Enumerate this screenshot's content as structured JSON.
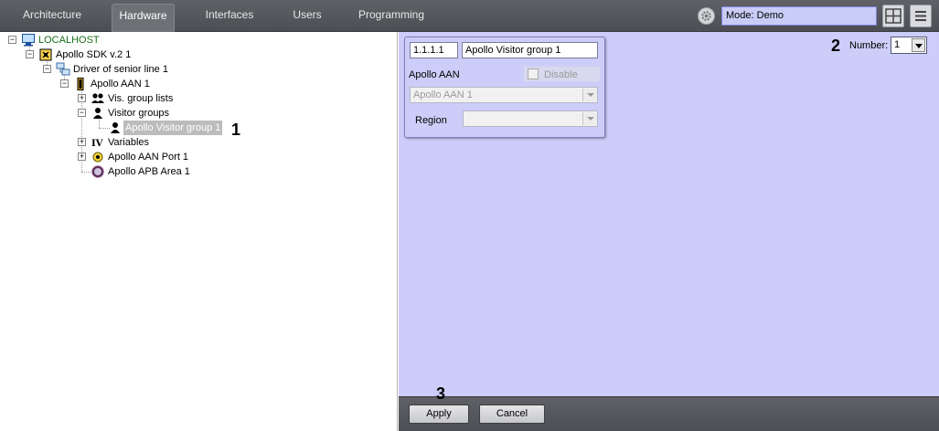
{
  "tabs": [
    {
      "label": "Architecture"
    },
    {
      "label": "Hardware"
    },
    {
      "label": "Interfaces"
    },
    {
      "label": "Users"
    },
    {
      "label": "Programming"
    }
  ],
  "active_tab": "Hardware",
  "mode_box": {
    "text": "Mode: Demo"
  },
  "tree": {
    "items": [
      {
        "label": "LOCALHOST",
        "icon": "computer-icon",
        "color": "#1a6e1a"
      },
      {
        "label": "Apollo SDK v.2 1",
        "icon": "chip-icon"
      },
      {
        "label": "Driver of senior line 1",
        "icon": "network-icon"
      },
      {
        "label": "Apollo AAN 1",
        "icon": "device-icon"
      },
      {
        "label": "Vis. group lists",
        "icon": "users-icon"
      },
      {
        "label": "Visitor groups",
        "icon": "user-icon"
      },
      {
        "label": "Apollo Visitor group 1",
        "icon": "user-icon",
        "selected": true
      },
      {
        "label": "Variables",
        "icon": "variables-icon"
      },
      {
        "label": "Apollo AAN Port 1",
        "icon": "port-icon"
      },
      {
        "label": "Apollo APB Area 1",
        "icon": "area-icon"
      }
    ]
  },
  "markers": {
    "m1": "1",
    "m2": "2",
    "m3": "3"
  },
  "settings": {
    "id_value": "1.1.1.1",
    "name_value": "Apollo Visitor group 1",
    "section_label": "Apollo AAN",
    "disable_label": "Disable",
    "aan_value": "Apollo AAN 1",
    "region_label": "Region",
    "region_value": ""
  },
  "number": {
    "label": "Number:",
    "value": "1"
  },
  "buttons": {
    "apply": "Apply",
    "cancel": "Cancel"
  }
}
